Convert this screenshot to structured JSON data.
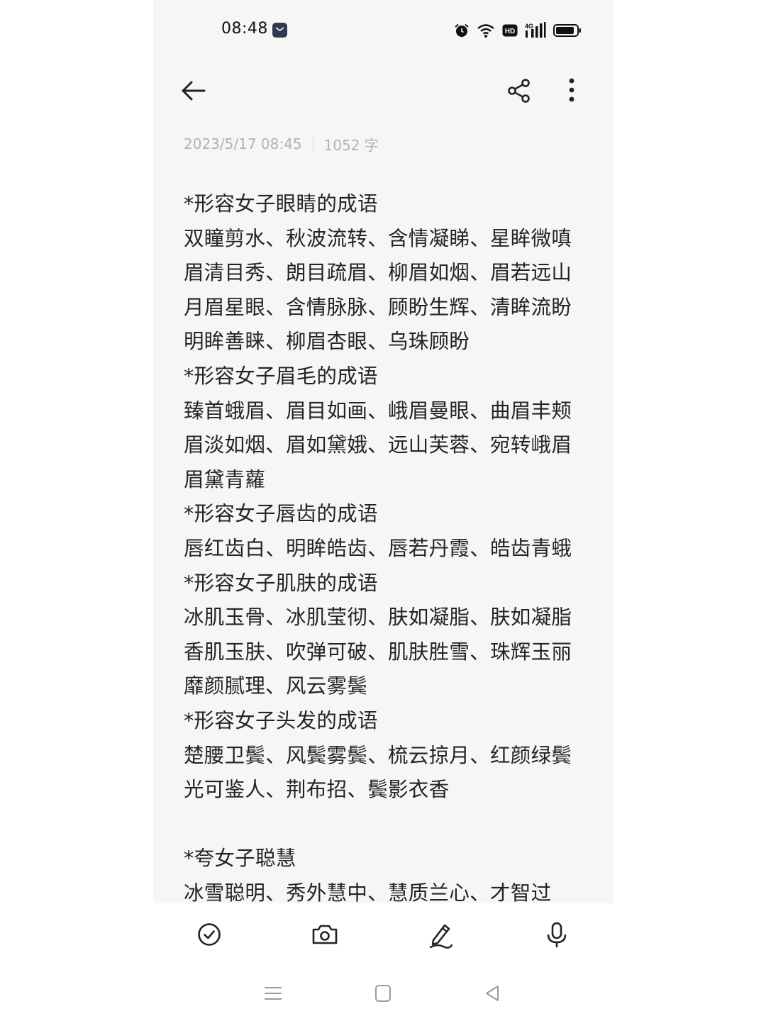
{
  "status_bar": {
    "time": "08:48",
    "network_label": "4G",
    "hd_label": "HD",
    "icons": [
      "chat-notification-icon",
      "alarm-icon",
      "wifi-icon",
      "hd-icon",
      "signal-4g-icon",
      "battery-icon"
    ]
  },
  "header": {
    "icons": [
      "back-arrow-icon",
      "share-icon",
      "more-vertical-icon"
    ]
  },
  "meta": {
    "datetime": "2023/5/17 08:45",
    "word_count": "1052 字"
  },
  "note": {
    "lines": [
      "*形容女子眼睛的成语",
      "双瞳剪水、秋波流转、含情凝睇、星眸微嗔",
      "眉清目秀、朗目疏眉、柳眉如烟、眉若远山",
      "月眉星眼、含情脉脉、顾盼生辉、清眸流盼",
      "明眸善睐、柳眉杏眼、乌珠顾盼",
      "*形容女子眉毛的成语",
      "臻首蛾眉、眉目如画、峨眉曼眼、曲眉丰颊",
      "眉淡如烟、眉如黛娥、远山芙蓉、宛转峨眉",
      "眉黛青蘿",
      "*形容女子唇齿的成语",
      "唇红齿白、明眸皓齿、唇若丹霞、皓齿青蛾",
      "*形容女子肌肤的成语",
      "冰肌玉骨、冰肌莹彻、肤如凝脂、肤如凝脂",
      "香肌玉肤、吹弹可破、肌肤胜雪、珠辉玉丽",
      "靡颜腻理、风云雾鬓",
      "*形容女子头发的成语",
      "楚腰卫鬓、风鬓雾鬓、梳云掠月、红颜绿鬓",
      "光可鉴人、荆布招、鬓影衣香",
      "",
      "*夸女子聪慧",
      "冰雪聪明、秀外慧中、慧质兰心、才智过"
    ]
  },
  "toolbar": {
    "icons": [
      "checklist-icon",
      "camera-icon",
      "handwriting-pen-icon",
      "microphone-icon"
    ]
  },
  "nav_bar": {
    "icons": [
      "recent-apps-icon",
      "home-icon",
      "back-triangle-icon"
    ]
  },
  "colors": {
    "background": "#f6f6f6",
    "text": "#242424",
    "meta_text": "#b2b2b2",
    "icon": "#222222"
  }
}
